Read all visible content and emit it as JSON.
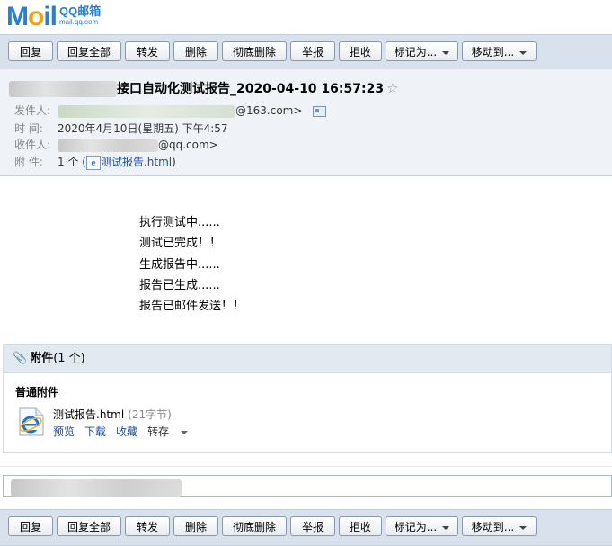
{
  "logo": {
    "brand_m": "M",
    "brand_o": "o",
    "brand_il": "il",
    "line1": "QQ邮箱",
    "line2": "mail.qq.com"
  },
  "toolbar": {
    "reply": "回复",
    "reply_all": "回复全部",
    "forward": "转发",
    "delete": "删除",
    "delete_permanently": "彻底删除",
    "report": "举报",
    "reject": "拒收",
    "mark_as": "标记为...",
    "move_to": "移动到..."
  },
  "email": {
    "subject": "接口自动化测试报告_2020-04-10 16:57:23",
    "sender_label": "发件人:",
    "sender_suffix": "@163.com>",
    "time_label": "时  间:",
    "time_value": "2020年4月10日(星期五) 下午4:57",
    "recipient_label": "收件人:",
    "recipient_suffix": "@qq.com>",
    "attachment_label": "附  件:",
    "attachment_count": "1 个 (",
    "attachment_link": "测试报告.html",
    "attachment_close": ")",
    "body_lines": [
      "执行测试中......",
      "测试已完成！！",
      "生成报告中......",
      "报告已生成......",
      "报告已邮件发送！！"
    ]
  },
  "attachments": {
    "title": "附件",
    "count": "(1 个)",
    "section": "普通附件",
    "file_name": "测试报告.html",
    "file_size": "(21字节)",
    "actions": {
      "preview": "预览",
      "download": "下载",
      "favorite": "收藏",
      "save_to": "转存"
    }
  },
  "colors": {
    "toolbar_bg": "#d9e1ec",
    "header_bg": "#eff3f7",
    "link": "#1e4fa0",
    "brand_blue": "#2a7fd0",
    "brand_orange": "#f2a20a"
  }
}
